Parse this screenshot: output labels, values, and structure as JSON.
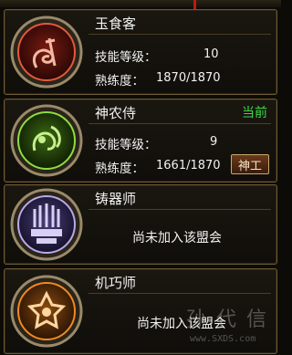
{
  "professions": [
    {
      "name": "玉食客",
      "skill_label": "技能等级：",
      "skill_value": "10",
      "prof_label": "熟练度：",
      "prof_value": "1870/1870",
      "icon": "gourmet-emblem-icon",
      "accent": "#d4452e"
    },
    {
      "name": "神农侍",
      "status": "当前",
      "skill_label": "技能等级：",
      "skill_value": "9",
      "prof_label": "熟练度：",
      "prof_value": "1661/1870",
      "action_label": "神工",
      "icon": "herbalist-emblem-icon",
      "accent": "#7cd23a"
    },
    {
      "name": "铸器师",
      "message": "尚未加入该盟会",
      "icon": "forge-emblem-icon",
      "accent": "#b9a9e8"
    },
    {
      "name": "机巧师",
      "message": "尚未加入该盟会",
      "icon": "mechanic-emblem-icon",
      "accent": "#f08a1e"
    }
  ],
  "watermark": {
    "glyphs": "孙 代 信",
    "url": "www.SXDS.com"
  }
}
